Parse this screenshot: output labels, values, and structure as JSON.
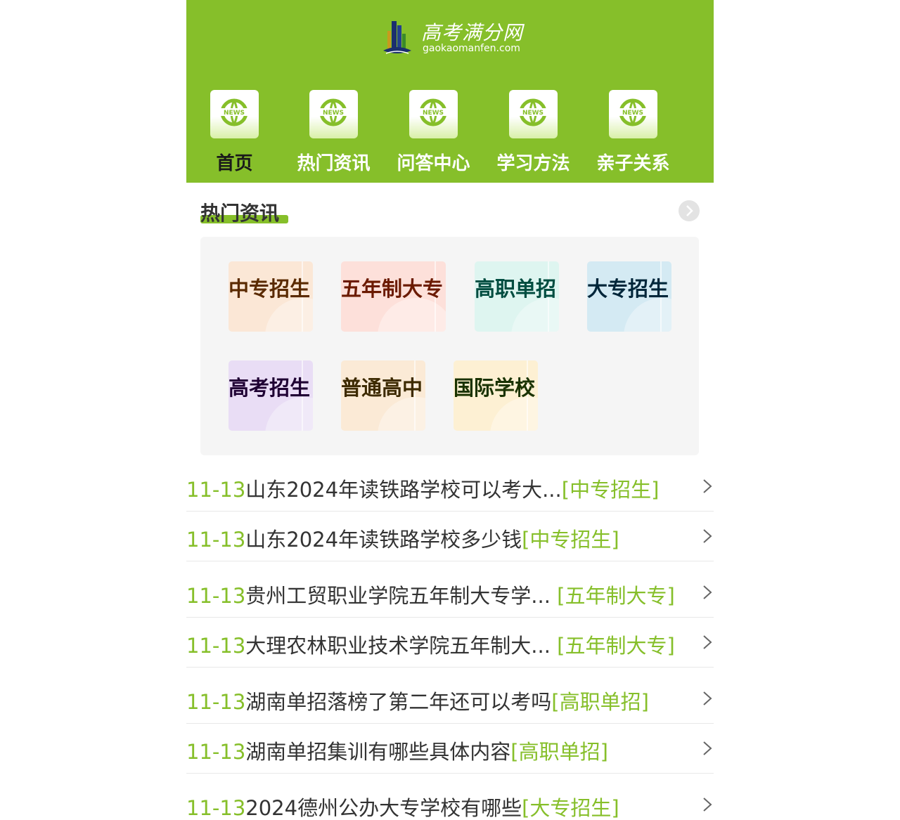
{
  "header": {
    "logo_title": "高考满分网",
    "logo_domain": "gaokaomanfen.com",
    "nav": [
      {
        "label": "首页",
        "icon": "news-globe-icon",
        "active": true
      },
      {
        "label": "热门资讯",
        "icon": "news-globe-icon"
      },
      {
        "label": "问答中心",
        "icon": "news-globe-icon"
      },
      {
        "label": "学习方法",
        "icon": "news-globe-icon"
      },
      {
        "label": "亲子关系",
        "icon": "news-globe-icon"
      }
    ],
    "icon_text": "NEWS"
  },
  "section": {
    "title": "热门资讯",
    "more_icon": "chevron-right-icon"
  },
  "categories": [
    {
      "label": "中专招生",
      "color": "#5a2a00",
      "bg": "#fbe7d6"
    },
    {
      "label": "五年制大专",
      "color": "#6b1a00",
      "bg": "#fde0da"
    },
    {
      "label": "高职单招",
      "color": "#004d40",
      "bg": "#def5f0"
    },
    {
      "label": "大专招生",
      "color": "#00263a",
      "bg": "#d4eaf3"
    },
    {
      "label": "高考招生",
      "color": "#1f0033",
      "bg": "#e9ddf5"
    },
    {
      "label": "普通高中",
      "color": "#3d2a00",
      "bg": "#fbead6"
    },
    {
      "label": "国际学校",
      "color": "#1a3300",
      "bg": "#fdf0d3"
    }
  ],
  "news": [
    {
      "date": "11-13",
      "title": "山东2024年读铁路学校可以考大...",
      "tag": "[中专招生]"
    },
    {
      "date": "11-13",
      "title": "山东2024年读铁路学校多少钱",
      "tag": "[中专招生]"
    },
    {
      "date": "11-13",
      "title": "贵州工贸职业学院五年制大专学... ",
      "tag": "[五年制大专]"
    },
    {
      "date": "11-13",
      "title": "大理农林职业技术学院五年制大... ",
      "tag": "[五年制大专]"
    },
    {
      "date": "11-13",
      "title": "湖南单招落榜了第二年还可以考吗",
      "tag": "[高职单招]"
    },
    {
      "date": "11-13",
      "title": "湖南单招集训有哪些具体内容",
      "tag": "[高职单招]"
    },
    {
      "date": "11-13",
      "title": "2024德州公办大专学校有哪些",
      "tag": "[大专招生]"
    }
  ],
  "colors": {
    "brand": "#86bf2a",
    "text": "#333333"
  }
}
